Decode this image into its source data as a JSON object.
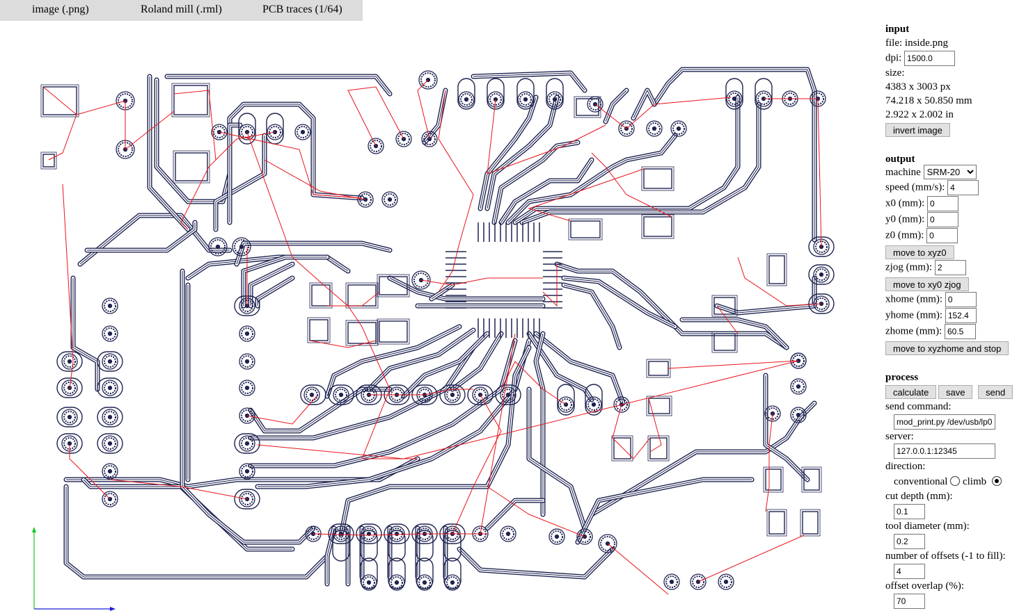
{
  "menu": {
    "items": [
      "image (.png)",
      "Roland mill (.rml)",
      "PCB traces (1/64)"
    ]
  },
  "input": {
    "title": "input",
    "file_label": "file:",
    "file_name": "inside.png",
    "dpi_label": "dpi:",
    "dpi_value": "1500.0",
    "size_label": "size:",
    "size_px": "4383 x 3003 px",
    "size_mm": "74.218 x 50.850 mm",
    "size_in": "2.922 x 2.002 in",
    "invert_button": "invert image"
  },
  "output": {
    "title": "output",
    "machine_label": "machine",
    "machine_value": "SRM-20",
    "speed_label": "speed (mm/s):",
    "speed_value": "4",
    "x0_label": "x0 (mm):",
    "x0_value": "0",
    "y0_label": "y0 (mm):",
    "y0_value": "0",
    "z0_label": "z0 (mm):",
    "z0_value": "0",
    "move_xyz0_button": "move to xyz0",
    "zjog_label": "zjog (mm):",
    "zjog_value": "2",
    "move_xy0_button": "move to xy0 zjog",
    "xhome_label": "xhome (mm):",
    "xhome_value": "0",
    "yhome_label": "yhome (mm):",
    "yhome_value": "152.4",
    "zhome_label": "zhome (mm):",
    "zhome_value": "60.5",
    "move_home_button": "move to xyzhome and stop"
  },
  "process": {
    "title": "process",
    "calculate_button": "calculate",
    "save_button": "save",
    "send_button": "send",
    "send_command_label": "send command:",
    "send_command_value": "mod_print.py /dev/usb/lp0",
    "server_label": "server:",
    "server_value": "127.0.0.1:12345",
    "direction_label": "direction:",
    "conventional_label": "conventional",
    "climb_label": "climb",
    "direction_selected": "climb",
    "cut_depth_label": "cut depth (mm):",
    "cut_depth_value": "0.1",
    "tool_diameter_label": "tool diameter (mm):",
    "tool_diameter_value": "0.2",
    "offsets_label": "number of offsets (-1 to fill):",
    "offsets_value": "4",
    "overlap_label": "offset overlap (%):",
    "overlap_value": "70"
  },
  "colors": {
    "trace": "#1e2350",
    "move": "#e8141a",
    "axis_x": "#1a1adc",
    "axis_y": "#14c81e",
    "menu_bg": "#dcdcdc"
  }
}
